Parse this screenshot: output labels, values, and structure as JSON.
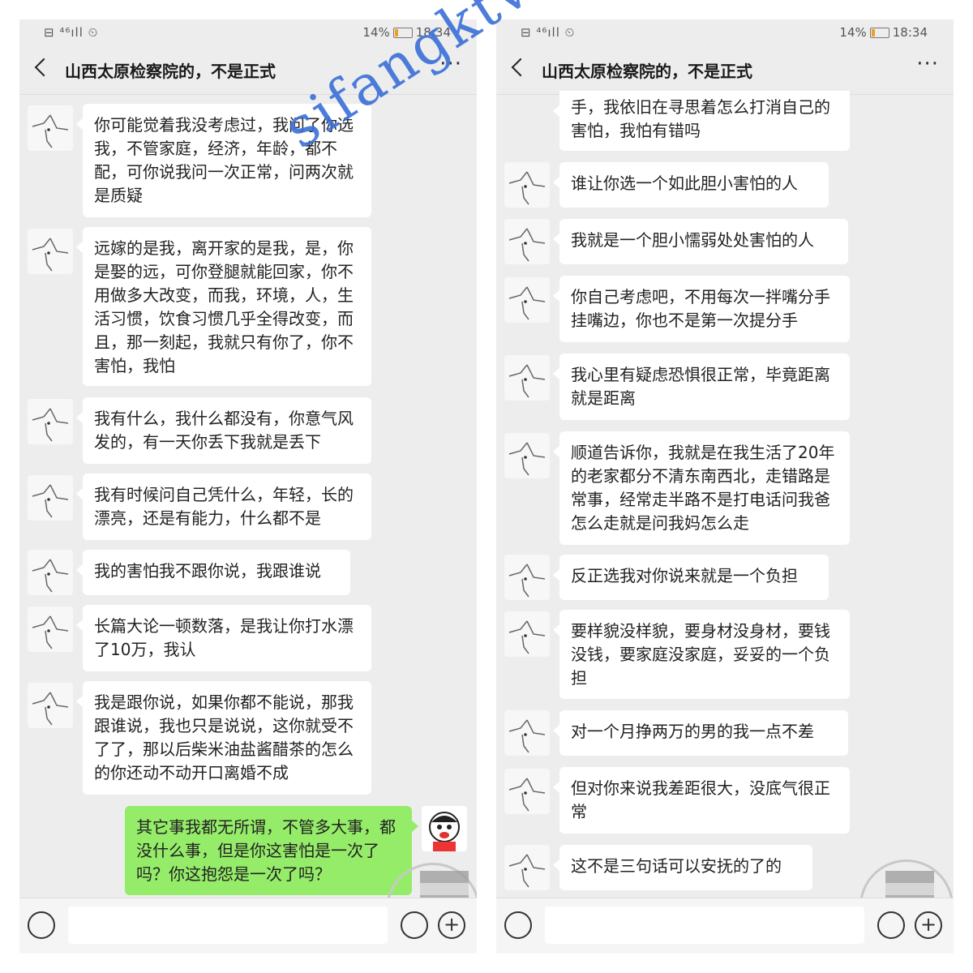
{
  "status": {
    "signal": "⊟ ⁴⁶ıll ⏲",
    "battery": "14%",
    "time": "18:34"
  },
  "chat_title": "山西太原检察院的，不是正式",
  "watermark": "sifangktv.com",
  "left": {
    "messages": [
      "你可能觉着我没考虑过，我问了你选我，不管家庭，经济，年龄，都不配，可你说我问一次正常，问两次就是质疑",
      "远嫁的是我，离开家的是我，是，你是娶的远，可你登腿就能回家，你不用做多大改变，而我，环境，人，生活习惯，饮食习惯几乎全得改变，而且，那一刻起，我就只有你了，你不害怕，我怕",
      "我有什么，我什么都没有，你意气风发的，有一天你丢下我就是丢下",
      "我有时候问自己凭什么，年轻，长的漂亮，还是有能力，什么都不是",
      "我的害怕我不跟你说，我跟谁说",
      "长篇大论一顿数落，是我让你打水漂了10万，我认",
      "我是跟你说，如果你都不能说，那我跟谁说，我也只是说说，这你就受不了了，那以后柴米油盐酱醋茶的怎么的你还动不动开口离婚不成"
    ],
    "my_message": "其它事我都无所谓，不管多大事，都没什么事，但是你这害怕是一次了吗？你这抱怨是一次了吗？"
  },
  "right": {
    "messages": [
      "手，我依旧在寻思着怎么打消自己的害怕，我怕有错吗",
      "谁让你选一个如此胆小害怕的人",
      "我就是一个胆小懦弱处处害怕的人",
      "你自己考虑吧，不用每次一拌嘴分手挂嘴边，你也不是第一次提分手",
      "我心里有疑虑恐惧很正常，毕竟距离就是距离",
      "顺道告诉你，我就是在我生活了20年的老家都分不清东南西北，走错路是常事，经常走半路不是打电话问我爸怎么走就是问我妈怎么走",
      "反正选我对你说来就是一个负担",
      "要样貌没样貌，要身材没身材，要钱没钱，要家庭没家庭，妥妥的一个负担",
      "对一个月挣两万的男的我一点不差",
      "但对你来说我差距很大，没底气很正常",
      "这不是三句话可以安抚的了的"
    ]
  }
}
